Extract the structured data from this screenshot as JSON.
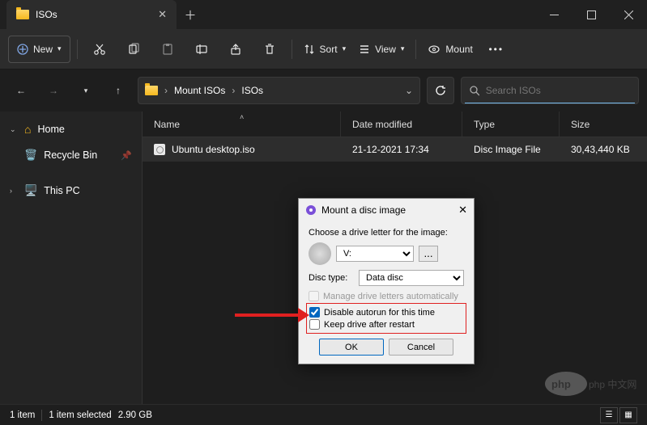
{
  "window": {
    "title": "ISOs"
  },
  "toolbar": {
    "new_label": "New",
    "sort_label": "Sort",
    "view_label": "View",
    "mount_label": "Mount"
  },
  "breadcrumb": {
    "part1": "Mount ISOs",
    "part2": "ISOs"
  },
  "search": {
    "placeholder": "Search ISOs"
  },
  "sidebar": {
    "home": "Home",
    "recycle": "Recycle Bin",
    "thispc": "This PC"
  },
  "columns": {
    "name": "Name",
    "date": "Date modified",
    "type": "Type",
    "size": "Size"
  },
  "files": [
    {
      "name": "Ubuntu desktop.iso",
      "date": "21-12-2021 17:34",
      "type": "Disc Image File",
      "size": "30,43,440 KB"
    }
  ],
  "status": {
    "count": "1 item",
    "selected": "1 item selected",
    "size": "2.90 GB"
  },
  "dialog": {
    "title": "Mount a disc image",
    "choose_label": "Choose a drive letter for the image:",
    "drive_value": "V:",
    "disc_type_label": "Disc type:",
    "disc_type_value": "Data disc",
    "manage_label": "Manage drive letters automatically",
    "disable_autorun_label": "Disable autorun for this time",
    "keep_drive_label": "Keep drive after restart",
    "ok": "OK",
    "cancel": "Cancel"
  },
  "watermark": "php 中文网"
}
